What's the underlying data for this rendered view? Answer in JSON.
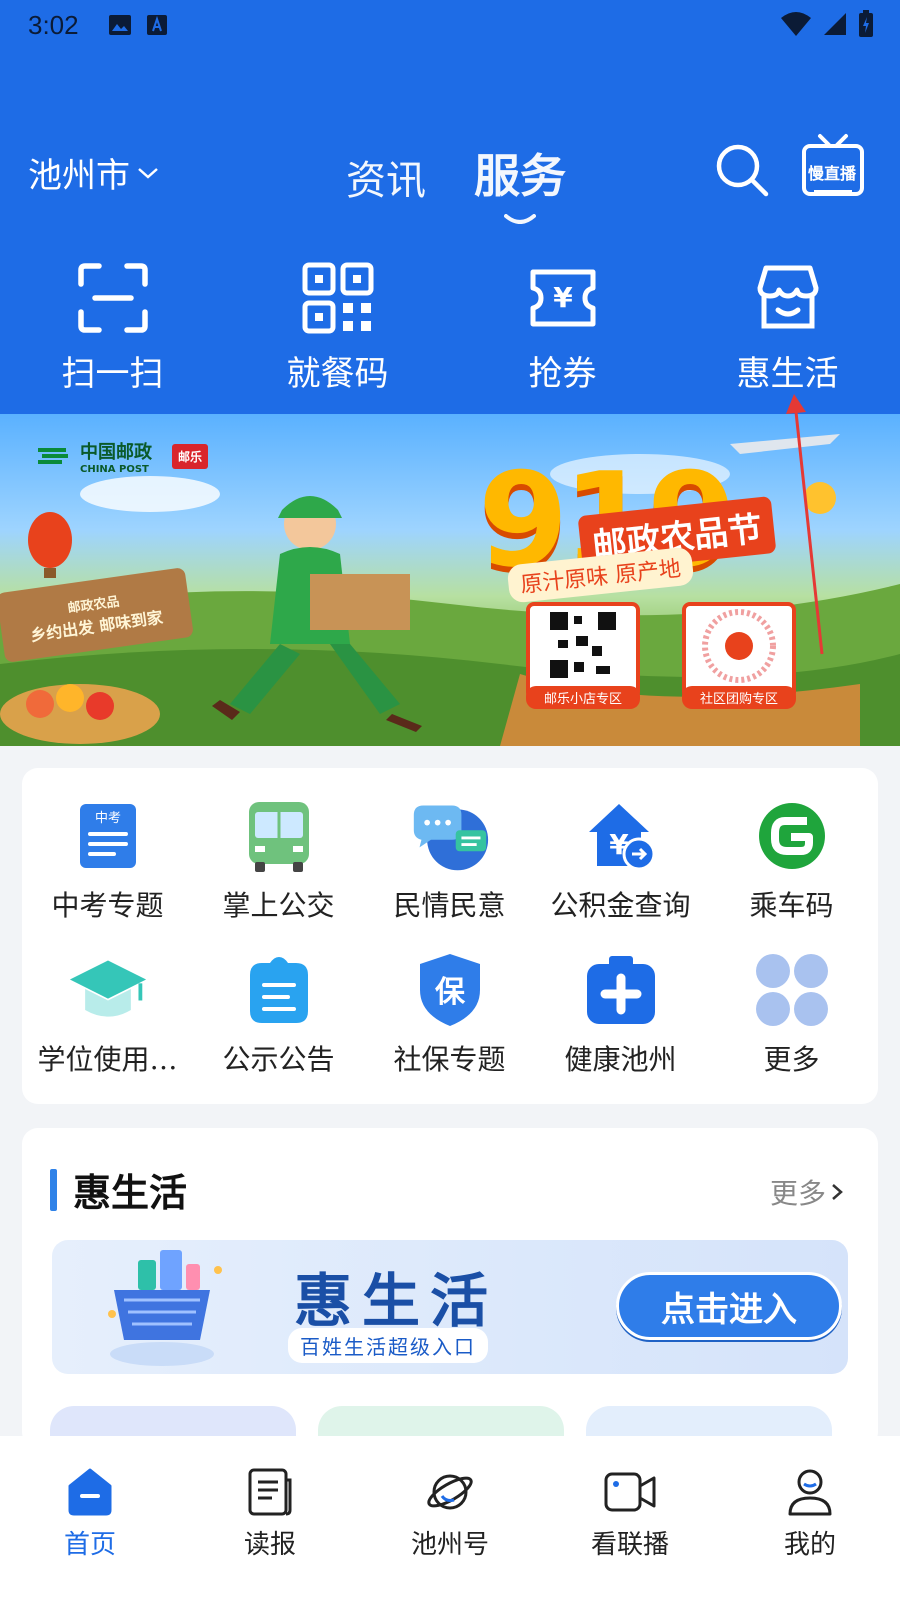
{
  "status": {
    "time": "3:02"
  },
  "header": {
    "city": "池州市",
    "tabs": [
      {
        "label": "资讯"
      },
      {
        "label": "服务"
      }
    ],
    "live_label": "慢直播"
  },
  "quick_actions": [
    {
      "label": "扫一扫",
      "icon": "scan-icon"
    },
    {
      "label": "就餐码",
      "icon": "qr-code-icon"
    },
    {
      "label": "抢券",
      "icon": "coupon-icon"
    },
    {
      "label": "惠生活",
      "icon": "shop-icon"
    }
  ],
  "banner": {
    "logo_cn": "中国邮政",
    "logo_en": "CHINA POST",
    "badge": "邮乐",
    "big_number": "919",
    "festival": "邮政农品节",
    "subtitle": "原汁原味 原产地",
    "sign_line1": "邮政农品",
    "sign_line2": "乡约出发 邮味到家",
    "qr_left_label": "邮乐小店专区",
    "qr_right_label": "社区团购专区"
  },
  "services": [
    {
      "label": "中考专题",
      "icon": "exam-doc-icon"
    },
    {
      "label": "掌上公交",
      "icon": "bus-icon"
    },
    {
      "label": "民情民意",
      "icon": "chat-bubbles-icon"
    },
    {
      "label": "公积金查询",
      "icon": "housing-fund-icon"
    },
    {
      "label": "乘车码",
      "icon": "ride-code-icon"
    },
    {
      "label": "学位使用…",
      "icon": "graduation-cap-icon"
    },
    {
      "label": "公示公告",
      "icon": "notice-icon"
    },
    {
      "label": "社保专题",
      "icon": "social-security-shield-icon"
    },
    {
      "label": "健康池州",
      "icon": "medical-kit-icon"
    },
    {
      "label": "更多",
      "icon": "more-grid-icon"
    }
  ],
  "life_section": {
    "title": "惠生活",
    "more": "更多",
    "banner_title": "惠生活",
    "banner_sub": "百姓生活超级入口",
    "enter_button": "点击进入"
  },
  "bottom_nav": [
    {
      "label": "首页",
      "icon": "home-icon",
      "active": true
    },
    {
      "label": "读报",
      "icon": "newspaper-icon",
      "active": false
    },
    {
      "label": "池州号",
      "icon": "planet-icon",
      "active": false
    },
    {
      "label": "看联播",
      "icon": "video-camera-icon",
      "active": false
    },
    {
      "label": "我的",
      "icon": "profile-icon",
      "active": false
    }
  ],
  "colors": {
    "brand_blue": "#1e6ce6",
    "annotation_red": "#e53935"
  }
}
